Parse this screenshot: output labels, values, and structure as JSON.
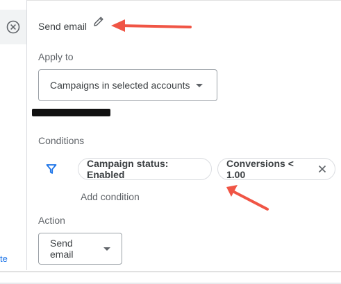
{
  "left_rail": {
    "link_fragment": "te"
  },
  "header": {
    "title": "Send email"
  },
  "apply_to": {
    "label": "Apply to",
    "value": "Campaigns in selected accounts"
  },
  "conditions": {
    "label": "Conditions",
    "chips": [
      {
        "label": "Campaign status: Enabled"
      },
      {
        "label": "Conversions < 1.00"
      }
    ],
    "add_label": "Add condition"
  },
  "action": {
    "label": "Action",
    "value": "Send email"
  },
  "colors": {
    "accent": "#1a73e8",
    "annotation_arrow": "#f05545",
    "redaction": "#111111"
  }
}
